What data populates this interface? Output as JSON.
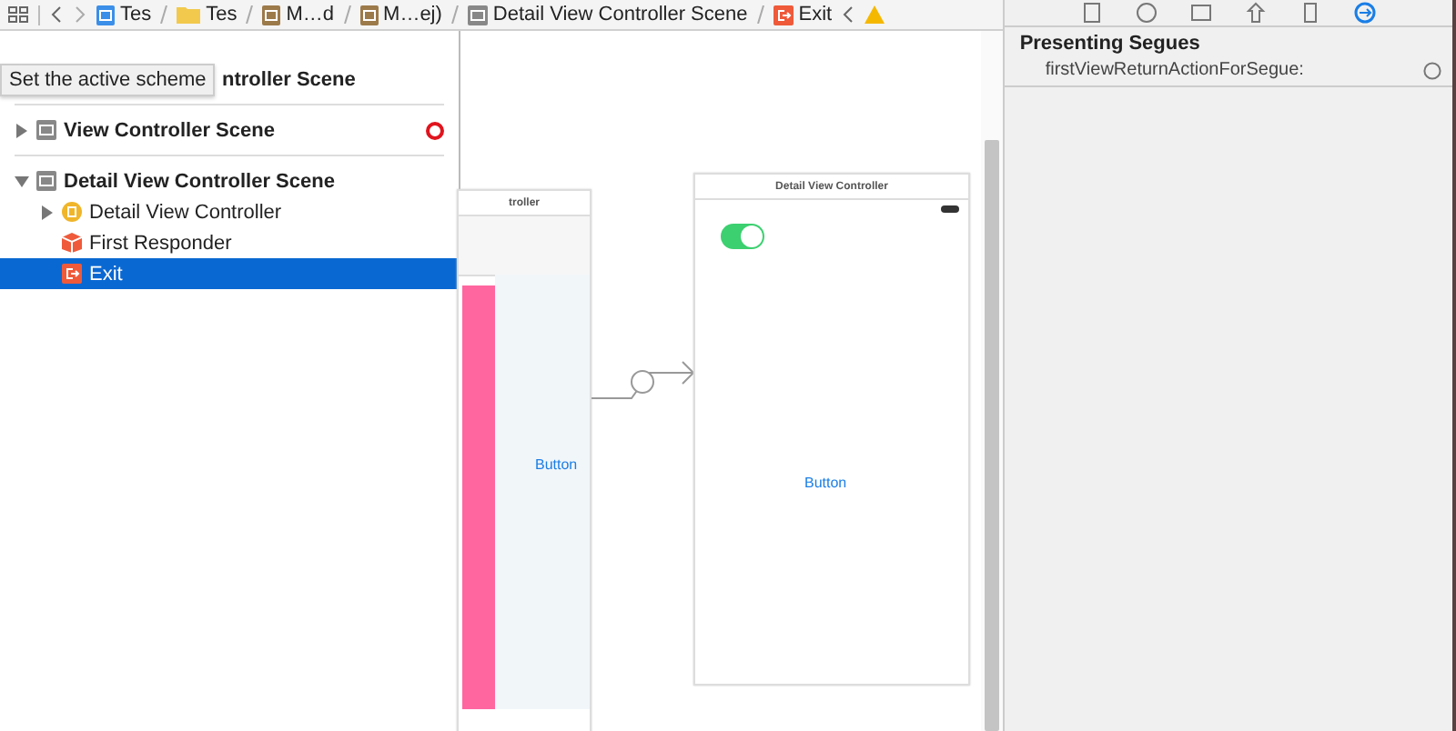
{
  "breadcrumb": {
    "items": [
      {
        "kind": "file",
        "label": "Tes"
      },
      {
        "kind": "folder",
        "label": "Tes"
      },
      {
        "kind": "storyboard",
        "label": "M…d"
      },
      {
        "kind": "storyboard",
        "label": "M…ej)"
      },
      {
        "kind": "scene",
        "label": "Detail View Controller Scene"
      },
      {
        "kind": "exit",
        "label": "Exit"
      }
    ]
  },
  "navigator": {
    "tooltip": "Set the active scheme",
    "scenes": [
      {
        "label": "ntroller Scene",
        "selected": false
      },
      {
        "label": "View Controller Scene",
        "expanded": false,
        "warning": true,
        "selected": false
      },
      {
        "label": "Detail View Controller Scene",
        "expanded": true,
        "warning": false,
        "selected": false,
        "children": [
          {
            "kind": "controller",
            "label": "Detail View Controller",
            "expanded": false,
            "selected": false
          },
          {
            "kind": "responder",
            "label": "First Responder",
            "selected": false
          },
          {
            "kind": "exit",
            "label": "Exit",
            "selected": true
          }
        ]
      }
    ]
  },
  "canvas": {
    "scenes": [
      {
        "title": "troller",
        "button": "Button"
      },
      {
        "title": "Detail View Controller",
        "switch_on": true,
        "button": "Button"
      }
    ]
  },
  "inspector": {
    "tabs": [
      {
        "kind": "file",
        "selected": false
      },
      {
        "kind": "help",
        "selected": false
      },
      {
        "kind": "identity",
        "selected": false
      },
      {
        "kind": "attributes",
        "selected": false
      },
      {
        "kind": "size",
        "selected": false
      },
      {
        "kind": "connections",
        "selected": true
      }
    ],
    "section": "Presenting Segues",
    "rows": [
      {
        "label": "firstViewReturnActionForSegue:",
        "connected": false
      }
    ]
  }
}
